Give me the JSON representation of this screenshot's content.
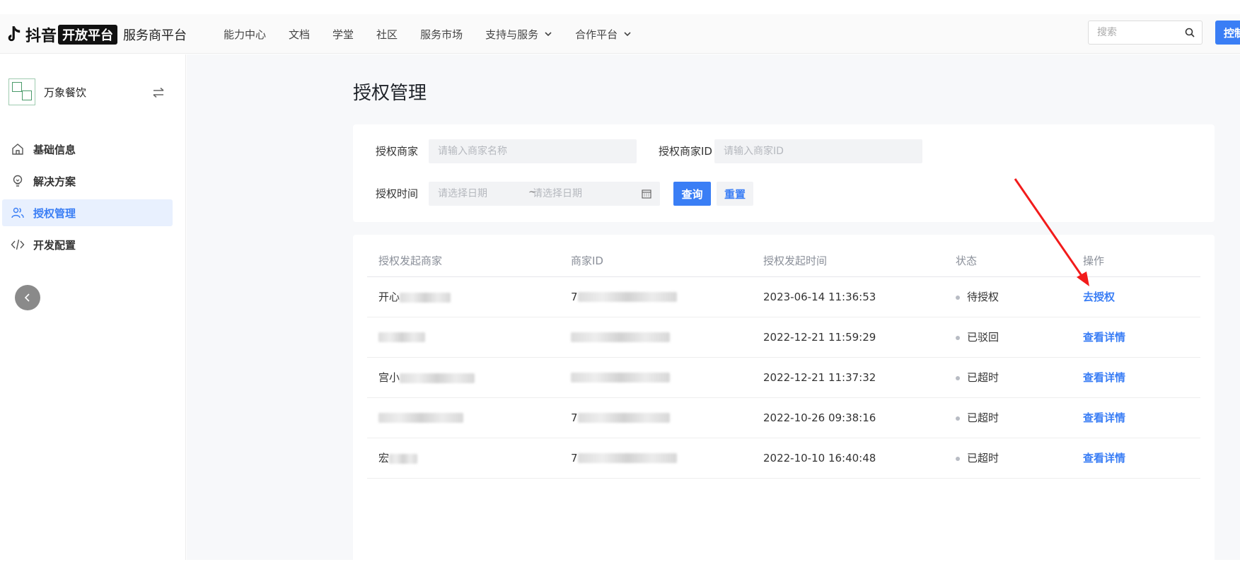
{
  "header": {
    "brand_name": "抖音",
    "brand_badge": "开放平台",
    "brand_sub": "服务商平台",
    "nav": [
      {
        "label": "能力中心",
        "dropdown": false
      },
      {
        "label": "文档",
        "dropdown": false
      },
      {
        "label": "学堂",
        "dropdown": false
      },
      {
        "label": "社区",
        "dropdown": false
      },
      {
        "label": "服务市场",
        "dropdown": false
      },
      {
        "label": "支持与服务",
        "dropdown": true
      },
      {
        "label": "合作平台",
        "dropdown": true
      }
    ],
    "search_placeholder": "搜索",
    "console_label": "控制"
  },
  "sidebar": {
    "store_name": "万象餐饮",
    "items": [
      {
        "label": "基础信息",
        "icon": "home-icon",
        "active": false
      },
      {
        "label": "解决方案",
        "icon": "lightbulb-icon",
        "active": false
      },
      {
        "label": "授权管理",
        "icon": "users-icon",
        "active": true
      },
      {
        "label": "开发配置",
        "icon": "code-icon",
        "active": false
      }
    ]
  },
  "main": {
    "title": "授权管理",
    "filters": {
      "merchant_label": "授权商家",
      "merchant_placeholder": "请输入商家名称",
      "merchant_id_label": "授权商家ID",
      "merchant_id_placeholder": "请输入商家ID",
      "time_label": "授权时间",
      "start_placeholder": "请选择日期",
      "range_separator": "~",
      "end_placeholder": "请选择日期",
      "query_label": "查询",
      "reset_label": "重置"
    },
    "table": {
      "columns": [
        "授权发起商家",
        "商家ID",
        "授权发起时间",
        "状态",
        "操作"
      ],
      "rows": [
        {
          "merchant": "开心",
          "merchant_id": "7",
          "time": "2023-06-14 11:36:53",
          "status": "待授权",
          "action": "去授权"
        },
        {
          "merchant": "",
          "merchant_id": "",
          "time": "2022-12-21 11:59:29",
          "status": "已驳回",
          "action": "查看详情"
        },
        {
          "merchant": "宫小",
          "merchant_id": "",
          "time": "2022-12-21 11:37:32",
          "status": "已超时",
          "action": "查看详情"
        },
        {
          "merchant": "",
          "merchant_id": "7",
          "time": "2022-10-26 09:38:16",
          "status": "已超时",
          "action": "查看详情"
        },
        {
          "merchant": "宏",
          "merchant_id": "7",
          "time": "2022-10-10 16:40:48",
          "status": "已超时",
          "action": "查看详情"
        }
      ]
    }
  },
  "colors": {
    "accent": "#3a7ef5",
    "active_bg": "#e8f0fe",
    "annotation_arrow": "#f21b1b"
  }
}
